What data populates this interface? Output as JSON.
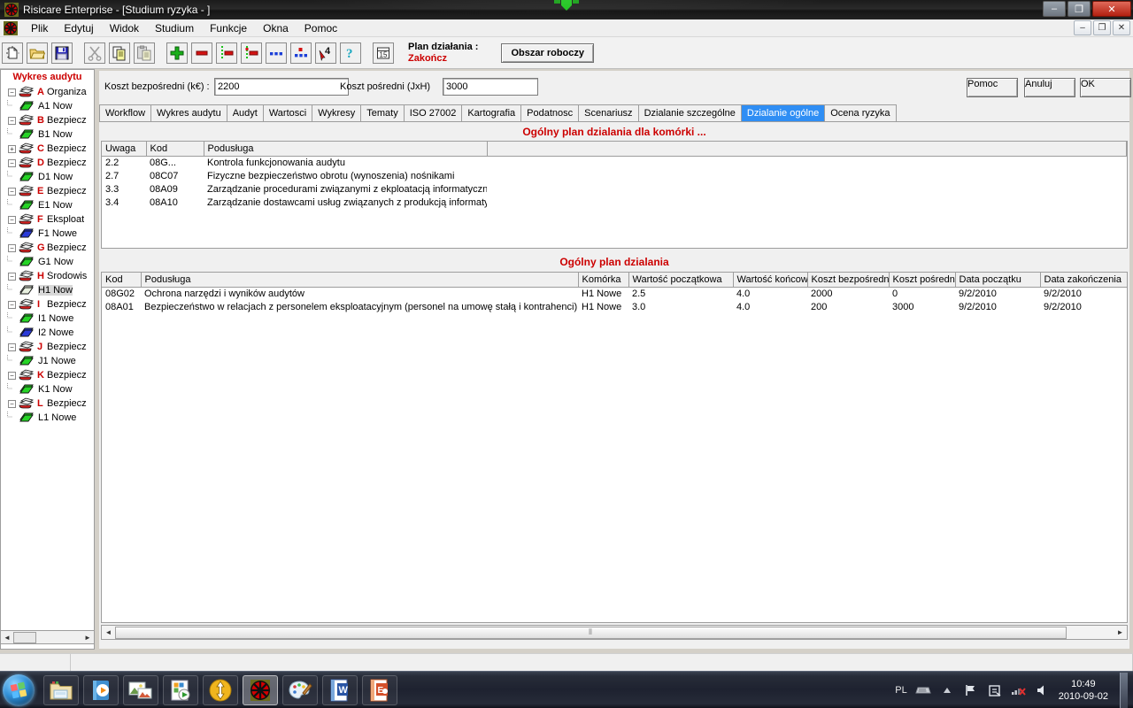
{
  "window": {
    "title": "Risicare Enterprise - [Studium ryzyka - ]",
    "minimize": "–",
    "restore": "❐",
    "close": "✕"
  },
  "mdi": {
    "minimize": "–",
    "restore": "❐",
    "close": "✕"
  },
  "menu": {
    "items": [
      {
        "label": "Plik"
      },
      {
        "label": "Edytuj"
      },
      {
        "label": "Widok"
      },
      {
        "label": "Studium"
      },
      {
        "label": "Funkcje"
      },
      {
        "label": "Okna"
      },
      {
        "label": "Pomoc"
      }
    ]
  },
  "toolbar": {
    "buttons": [
      {
        "name": "new-document-icon",
        "title": "Nowy"
      },
      {
        "name": "open-folder-icon",
        "title": "Otwórz"
      },
      {
        "name": "save-disk-icon",
        "title": "Zapisz"
      },
      {
        "name": "cut-scissors-icon",
        "title": "Wytnij"
      },
      {
        "name": "copy-icon",
        "title": "Kopiuj"
      },
      {
        "name": "paste-icon",
        "title": "Wklej"
      },
      {
        "name": "add-plus-icon",
        "title": "Dodaj"
      },
      {
        "name": "remove-minus-icon",
        "title": "Usuń"
      },
      {
        "name": "list-green-icon",
        "title": "Lista"
      },
      {
        "name": "list-red-marker-icon",
        "title": "Lista 2"
      },
      {
        "name": "dots-blue-icon",
        "title": "Elementy"
      },
      {
        "name": "chart-dots-icon",
        "title": "Wykres"
      },
      {
        "name": "pointer-four-icon",
        "title": "Wybierz"
      },
      {
        "name": "help-question-icon",
        "title": "Pomoc"
      },
      {
        "name": "calendar-15-icon",
        "title": "Kalendarz"
      }
    ],
    "plan_label_1": "Plan działania :",
    "plan_label_2": "Zakończ",
    "workspace_button": "Obszar roboczy"
  },
  "sidebar": {
    "title": "Wykres audytu",
    "nodes": [
      {
        "expander": "−",
        "letter": "A",
        "label": "Organiza",
        "icon": "folder-stack-icon",
        "child": false
      },
      {
        "expander": "",
        "letter": "",
        "label": "A1 Now",
        "icon": "green-book-icon",
        "child": true
      },
      {
        "expander": "−",
        "letter": "B",
        "label": "Bezpiecz",
        "icon": "folder-stack-icon",
        "child": false
      },
      {
        "expander": "",
        "letter": "",
        "label": "B1 Now",
        "icon": "green-book-icon",
        "child": true
      },
      {
        "expander": "+",
        "letter": "C",
        "label": "Bezpiecz",
        "icon": "folder-stack-icon",
        "child": false
      },
      {
        "expander": "−",
        "letter": "D",
        "label": "Bezpiecz",
        "icon": "folder-stack-icon",
        "child": false
      },
      {
        "expander": "",
        "letter": "",
        "label": "D1 Now",
        "icon": "green-book-icon",
        "child": true
      },
      {
        "expander": "−",
        "letter": "E",
        "label": "Bezpiecz",
        "icon": "folder-stack-icon",
        "child": false
      },
      {
        "expander": "",
        "letter": "",
        "label": "E1 Now",
        "icon": "green-book-icon",
        "child": true
      },
      {
        "expander": "−",
        "letter": "F",
        "label": "Eksploat",
        "icon": "folder-stack-icon",
        "child": false
      },
      {
        "expander": "",
        "letter": "",
        "label": "F1 Nowe",
        "icon": "blue-book-icon",
        "child": true
      },
      {
        "expander": "−",
        "letter": "G",
        "label": "Bezpiecz",
        "icon": "folder-stack-icon",
        "child": false
      },
      {
        "expander": "",
        "letter": "",
        "label": "G1 Now",
        "icon": "green-book-icon",
        "child": true
      },
      {
        "expander": "−",
        "letter": "H",
        "label": "Środowis",
        "icon": "folder-stack-icon",
        "child": false
      },
      {
        "expander": "",
        "letter": "",
        "label": "H1 Now",
        "icon": "pale-book-icon",
        "child": true,
        "selected": true
      },
      {
        "expander": "−",
        "letter": "I",
        "label": "Bezpiecz",
        "icon": "folder-stack-icon",
        "child": false
      },
      {
        "expander": "",
        "letter": "",
        "label": "I1 Nowe",
        "icon": "green-book-icon",
        "child": true
      },
      {
        "expander": "",
        "letter": "",
        "label": "I2 Nowe",
        "icon": "blue-book-icon",
        "child": true
      },
      {
        "expander": "−",
        "letter": "J",
        "label": "Bezpiecz",
        "icon": "folder-stack-icon",
        "child": false
      },
      {
        "expander": "",
        "letter": "",
        "label": "J1 Nowe",
        "icon": "green-book-icon",
        "child": true
      },
      {
        "expander": "−",
        "letter": "K",
        "label": "Bezpiecz",
        "icon": "folder-stack-icon",
        "child": false
      },
      {
        "expander": "",
        "letter": "",
        "label": "K1 Now",
        "icon": "green-book-icon",
        "child": true
      },
      {
        "expander": "−",
        "letter": "L",
        "label": "Bezpiecz",
        "icon": "folder-stack-icon",
        "child": false
      },
      {
        "expander": "",
        "letter": "",
        "label": "L1 Nowe",
        "icon": "green-book-icon",
        "child": true
      }
    ],
    "scroll_left": "◄",
    "scroll_right": "►"
  },
  "form": {
    "direct_cost_label": "Koszt bezpośredni (k€) :",
    "direct_cost_value": "2200",
    "indirect_cost_label": "Koszt pośredni (JxH)",
    "indirect_cost_value": "3000",
    "help_button": "Pomoc",
    "cancel_button": "Anuluj",
    "ok_button": "OK"
  },
  "tabs": [
    {
      "label": "Workflow",
      "active": false
    },
    {
      "label": "Wykres audytu",
      "active": false
    },
    {
      "label": "Audyt",
      "active": false
    },
    {
      "label": "Wartosci",
      "active": false
    },
    {
      "label": "Wykresy",
      "active": false
    },
    {
      "label": "Tematy",
      "active": false
    },
    {
      "label": "ISO 27002",
      "active": false
    },
    {
      "label": "Kartografia",
      "active": false
    },
    {
      "label": "Podatnosc",
      "active": false
    },
    {
      "label": "Scenariusz",
      "active": false
    },
    {
      "label": "Dzialanie szczególne",
      "active": false
    },
    {
      "label": "Dzialanie ogólne",
      "active": true
    },
    {
      "label": "Ocena ryzyka",
      "active": false
    }
  ],
  "upper_panel": {
    "title": "Ogólny plan dzialania dla komórki ...",
    "columns": [
      "Uwaga",
      "Kod",
      "Podusługa",
      ""
    ],
    "rows": [
      [
        "2.2",
        "08G...",
        "Kontrola funkcjonowania audytu",
        ""
      ],
      [
        "2.7",
        "08C07",
        "Fizyczne bezpieczeństwo obrotu (wynoszenia) nośnikami",
        ""
      ],
      [
        "3.3",
        "08A09",
        "Zarządzanie procedurami związanymi z ekploatacją informatyczną",
        ""
      ],
      [
        "3.4",
        "08A10",
        "Zarządzanie dostawcami usług związanych z produkcją informatyczną",
        ""
      ]
    ]
  },
  "lower_panel": {
    "title": "Ogólny plan dzialania",
    "columns": [
      "Kod",
      "Podusługa",
      "Komórka",
      "Wartość początkowa",
      "Wartość końcowa",
      "Koszt bezpośredni",
      "Koszt pośredni",
      "Data początku",
      "Data zakończenia"
    ],
    "rows": [
      [
        "08G02",
        "Ochrona narzędzi i wyników audytów",
        "H1 Nowe",
        "2.5",
        "4.0",
        "2000",
        "0",
        "9/2/2010",
        "9/2/2010"
      ],
      [
        "08A01",
        "Bezpieczeństwo w relacjach z personelem eksploatacyjnym (personel na umowę stałą i kontrahenci)",
        "H1 Nowe",
        "3.0",
        "4.0",
        "200",
        "3000",
        "9/2/2010",
        "9/2/2010"
      ]
    ],
    "scroll_left": "◄",
    "scroll_right": "►",
    "scroll_grip": "⦀"
  },
  "taskbar": {
    "start": "start-orb-icon",
    "items": [
      {
        "name": "explorer-icon",
        "active": false
      },
      {
        "name": "media-player-icon",
        "active": false
      },
      {
        "name": "photo-viewer-icon",
        "active": false
      },
      {
        "name": "presentation-play-icon",
        "active": false
      },
      {
        "name": "filezilla-icon",
        "active": false
      },
      {
        "name": "risicare-icon",
        "active": true
      },
      {
        "name": "paint-icon",
        "active": false
      },
      {
        "name": "word-icon",
        "active": false
      },
      {
        "name": "publisher-icon",
        "active": false
      }
    ],
    "tray": {
      "language": "PL",
      "icons": [
        "keyboard-icon",
        "show-hidden-icons-icon",
        "flag-icon",
        "action-center-icon",
        "network-disconnected-icon",
        "volume-icon"
      ],
      "time": "10:49",
      "date": "2010-09-02"
    }
  },
  "colors": {
    "accent_red": "#cc0000",
    "tab_active": "#2f8ef4",
    "window_bg": "#f0f0f0"
  }
}
